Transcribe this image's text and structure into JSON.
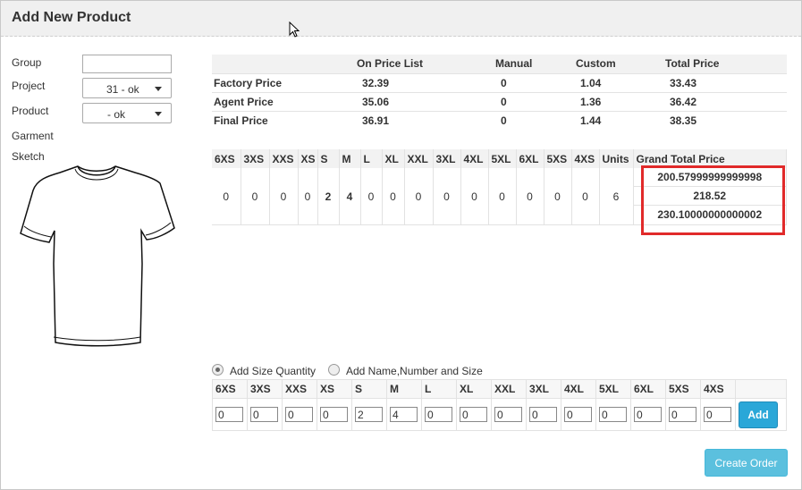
{
  "dialog": {
    "title": "Add New Product"
  },
  "form": {
    "group_label": "Group",
    "group_value": "",
    "project_label": "Project",
    "project_value": "31 - ok",
    "product_label": "Product",
    "product_value": "- ok",
    "garment_label": "Garment",
    "sketch_label": "Sketch"
  },
  "price_table": {
    "headers": [
      "",
      "On Price List",
      "Manual",
      "Custom",
      "Total Price"
    ],
    "rows": [
      {
        "name": "Factory Price",
        "on_price_list": "32.39",
        "manual": "0",
        "custom": "1.04",
        "total": "33.43"
      },
      {
        "name": "Agent Price",
        "on_price_list": "35.06",
        "manual": "0",
        "custom": "1.36",
        "total": "36.42"
      },
      {
        "name": "Final Price",
        "on_price_list": "36.91",
        "manual": "0",
        "custom": "1.44",
        "total": "38.35"
      }
    ]
  },
  "size_table": {
    "headers": [
      "6XS",
      "3XS",
      "XXS",
      "XS",
      "S",
      "M",
      "L",
      "XL",
      "XXL",
      "3XL",
      "4XL",
      "5XL",
      "6XL",
      "5XS",
      "4XS",
      "Units",
      "Grand Total Price"
    ],
    "values": [
      "0",
      "0",
      "0",
      "0",
      "2",
      "4",
      "0",
      "0",
      "0",
      "0",
      "0",
      "0",
      "0",
      "0",
      "0",
      "6"
    ],
    "grand_total": [
      "200.57999999999998",
      "218.52",
      "230.10000000000002"
    ]
  },
  "mode": {
    "option1": "Add Size Quantity",
    "option2": "Add Name,Number and Size",
    "selected": "option1"
  },
  "qty_table": {
    "headers": [
      "6XS",
      "3XS",
      "XXS",
      "XS",
      "S",
      "M",
      "L",
      "XL",
      "XXL",
      "3XL",
      "4XL",
      "5XL",
      "6XL",
      "5XS",
      "4XS"
    ],
    "values": [
      "0",
      "0",
      "0",
      "0",
      "2",
      "4",
      "0",
      "0",
      "0",
      "0",
      "0",
      "0",
      "0",
      "0",
      "0"
    ],
    "add_label": "Add"
  },
  "footer": {
    "create_order_label": "Create Order"
  },
  "colors": {
    "highlight_box": "#e12a2a",
    "button_blue": "#2aa7d8",
    "button_light_blue": "#5bc0de"
  }
}
